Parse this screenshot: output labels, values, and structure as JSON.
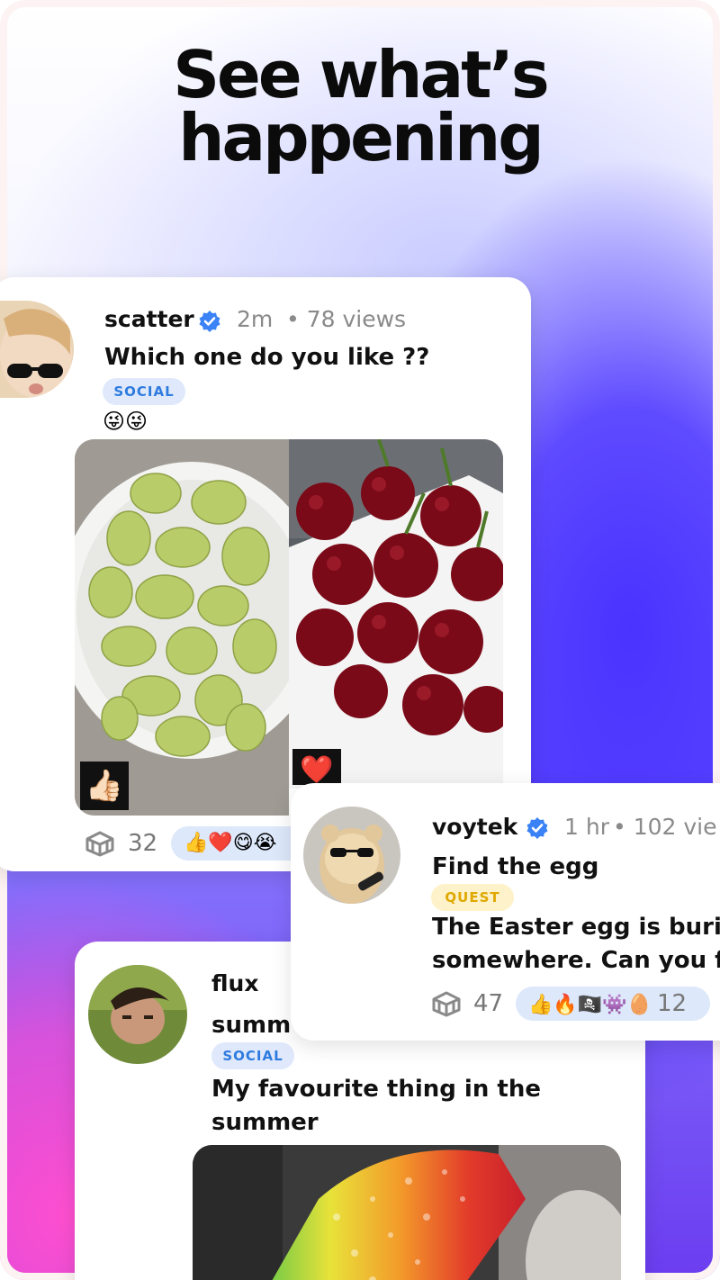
{
  "headline": {
    "line1": "See what’s",
    "line2": "happening"
  },
  "post1": {
    "username": "scatter",
    "time": "2m",
    "views": "• 78 views",
    "title": "Which one do you like ??",
    "tag": "SOCIAL",
    "emojis": "😜😜",
    "left_vote": "👍🏻",
    "right_vote": "❤️",
    "box_count": "32",
    "reactions": "👍❤️😋😭"
  },
  "post2": {
    "username": "voytek",
    "time": "1 hr",
    "views": "• 102 vie",
    "title": "Find the egg",
    "tag": "QUEST",
    "body_line1": "The Easter egg is burie",
    "body_line2": "somewhere. Can you fi",
    "box_count": "47",
    "reactions": "👍🔥🏴‍☠️👾🥚",
    "reaction_count": "12"
  },
  "post3": {
    "username": "flux",
    "subtitle": "summ",
    "tag": "SOCIAL",
    "body_line1": "My favourite thing in the",
    "body_line2": "summer"
  },
  "colors": {
    "verified": "#3b82f6",
    "social_tag": "#2e7be0",
    "quest_tag": "#e0a800",
    "accent_blue": "#4a33ff",
    "accent_pink": "#ff4fd0"
  },
  "icons": [
    "verified-badge-icon",
    "box-icon",
    "thumbs-up-icon",
    "heart-icon"
  ]
}
